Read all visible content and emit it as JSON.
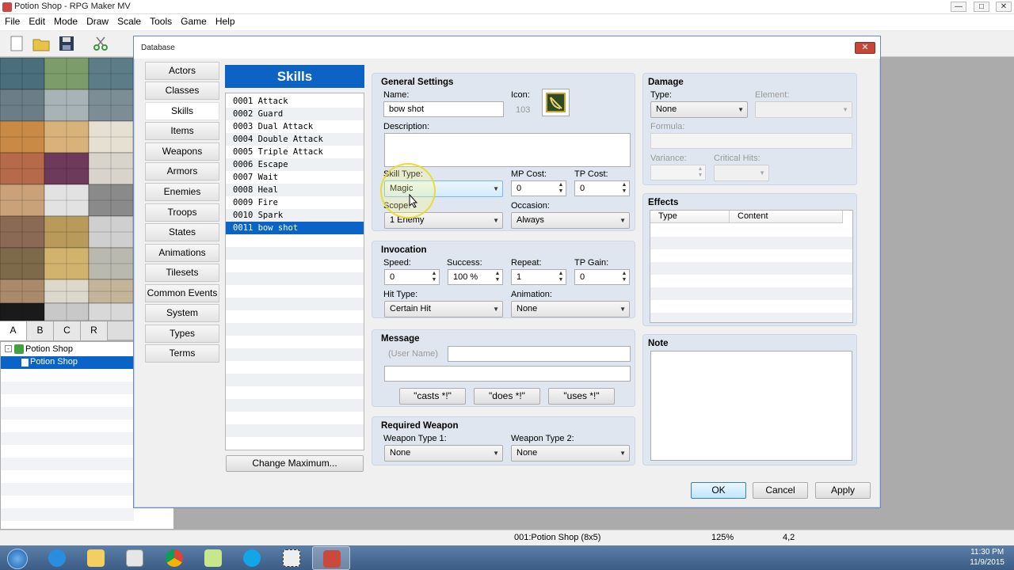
{
  "window": {
    "title": "Potion Shop - RPG Maker MV",
    "minimize": "—",
    "maximize": "□",
    "close": "✕"
  },
  "menu": [
    "File",
    "Edit",
    "Mode",
    "Draw",
    "Scale",
    "Tools",
    "Game",
    "Help"
  ],
  "palette_tabs": [
    "A",
    "B",
    "C",
    "R"
  ],
  "map_tree": {
    "project": "Potion Shop",
    "map": "Potion Shop"
  },
  "status_bar": {
    "map": "001:Potion Shop (8x5)",
    "zoom": "125%",
    "coords": "4,2"
  },
  "taskbar": {
    "time": "11:30 PM",
    "date": "11/9/2015"
  },
  "dialog": {
    "title": "Database",
    "close": "✕",
    "categories": [
      "Actors",
      "Classes",
      "Skills",
      "Items",
      "Weapons",
      "Armors",
      "Enemies",
      "Troops",
      "States",
      "Animations",
      "Tilesets",
      "Common Events",
      "System",
      "Types",
      "Terms"
    ],
    "selected_category": "Skills",
    "list_header": "Skills",
    "skills": [
      "0001 Attack",
      "0002 Guard",
      "0003 Dual Attack",
      "0004 Double Attack",
      "0005 Triple Attack",
      "0006 Escape",
      "0007 Wait",
      "0008 Heal",
      "0009 Fire",
      "0010 Spark",
      "0011 bow shot"
    ],
    "selected_skill": "0011 bow shot",
    "change_max": "Change Maximum...",
    "ok": "OK",
    "cancel": "Cancel",
    "apply": "Apply"
  },
  "general": {
    "title": "General Settings",
    "name_label": "Name:",
    "name_value": "bow shot",
    "icon_label": "Icon:",
    "icon_index": "103",
    "description_label": "Description:",
    "description_value": "",
    "skill_type_label": "Skill Type:",
    "skill_type_value": "Magic",
    "mp_cost_label": "MP Cost:",
    "mp_cost_value": "0",
    "tp_cost_label": "TP Cost:",
    "tp_cost_value": "0",
    "scope_label": "Scope:",
    "scope_value": "1 Enemy",
    "occasion_label": "Occasion:",
    "occasion_value": "Always"
  },
  "invocation": {
    "title": "Invocation",
    "speed_label": "Speed:",
    "speed_value": "0",
    "success_label": "Success:",
    "success_value": "100 %",
    "repeat_label": "Repeat:",
    "repeat_value": "1",
    "tp_gain_label": "TP Gain:",
    "tp_gain_value": "0",
    "hit_type_label": "Hit Type:",
    "hit_type_value": "Certain Hit",
    "animation_label": "Animation:",
    "animation_value": "None"
  },
  "message": {
    "title": "Message",
    "user_name": "(User Name)",
    "line1": "",
    "line2": "",
    "btn_casts": "\"casts *!\"",
    "btn_does": "\"does *!\"",
    "btn_uses": "\"uses *!\""
  },
  "required_weapon": {
    "title": "Required Weapon",
    "type1_label": "Weapon Type 1:",
    "type1_value": "None",
    "type2_label": "Weapon Type 2:",
    "type2_value": "None"
  },
  "damage": {
    "title": "Damage",
    "type_label": "Type:",
    "type_value": "None",
    "element_label": "Element:",
    "element_value": "",
    "formula_label": "Formula:",
    "formula_value": "",
    "variance_label": "Variance:",
    "variance_value": "",
    "critical_label": "Critical Hits:",
    "critical_value": ""
  },
  "effects": {
    "title": "Effects",
    "col_type": "Type",
    "col_content": "Content"
  },
  "note": {
    "title": "Note",
    "value": ""
  },
  "colors": {
    "accent": "#0d63c4",
    "selected_row": "#0a64c8",
    "panel_bg": "#dfe6ef"
  }
}
